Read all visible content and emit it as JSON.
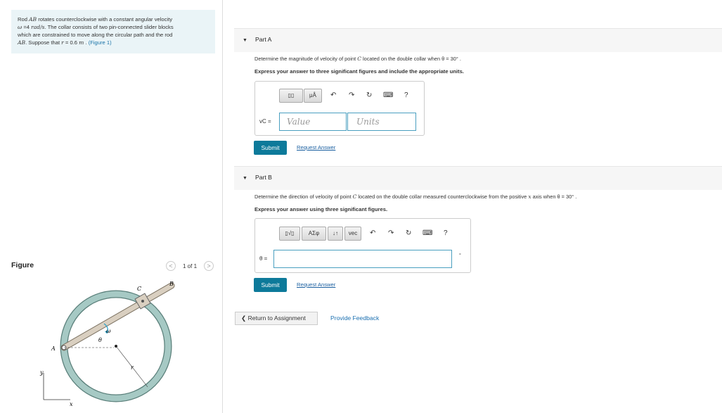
{
  "problem": {
    "line1_pre": "Rod ",
    "line1_var": "AB",
    "line1_post": " rotates counterclockwise with a constant angular velocity",
    "line2_var": "ω",
    "line2_value": " =4 ",
    "line2_unit": "rad/s",
    "line2_post": ". The collar consists of two pin-connected slider blocks",
    "line3": "which are constrained to move along the circular path and the rod",
    "line4_var": "AB",
    "line4_post": ". Suppose that ",
    "line4_r": "r",
    "line4_value": " = 0.6 ",
    "line4_unit": "m",
    "line4_dot": " . ",
    "figure_link": "(Figure 1)"
  },
  "figure": {
    "heading": "Figure",
    "prev_icon": "<",
    "counter": "1 of 1",
    "next_icon": ">",
    "labels": {
      "A": "A",
      "B": "B",
      "C": "C",
      "omega": "ω",
      "theta": "θ",
      "r": "r",
      "x": "x",
      "y": "y"
    }
  },
  "part_a": {
    "title": "Part A",
    "question_pre": "Determine the magnitude of velocity of point ",
    "question_var": "C",
    "question_post": " located on the double collar when θ = 30° .",
    "instruction": "Express your answer to three significant figures and include the appropriate units.",
    "toolbar": {
      "templates": "▯▯",
      "units": "μÅ",
      "undo": "↶",
      "redo": "↷",
      "reset": "↻",
      "keyboard": "⌨",
      "help": "?"
    },
    "field_label": "vC =",
    "value_placeholder": "Value",
    "units_placeholder": "Units",
    "submit_label": "Submit",
    "request_label": "Request Answer"
  },
  "part_b": {
    "title": "Part B",
    "question_pre": "Determine the direction of velocity of point ",
    "question_var": "C",
    "question_mid": " located on the double collar measured counterclockwise from the positive ",
    "question_x": "x",
    "question_post": " axis when θ = 30° .",
    "instruction": "Express your answer using three significant figures.",
    "toolbar": {
      "templates": "▯√▯",
      "greek": "ΑΣφ",
      "arrows": "↓↑",
      "vec": "vec",
      "undo": "↶",
      "redo": "↷",
      "reset": "↻",
      "keyboard": "⌨",
      "help": "?"
    },
    "field_label": "θ =",
    "unit_suffix": "°",
    "submit_label": "Submit",
    "request_label": "Request Answer"
  },
  "footer": {
    "return_label": "Return to Assignment",
    "feedback_label": "Provide Feedback"
  },
  "colors": {
    "accent": "#0d7a9a",
    "ring": "#a6c9c4",
    "ring_outline": "#5a7f7a",
    "rod": "#d9cfc0"
  }
}
